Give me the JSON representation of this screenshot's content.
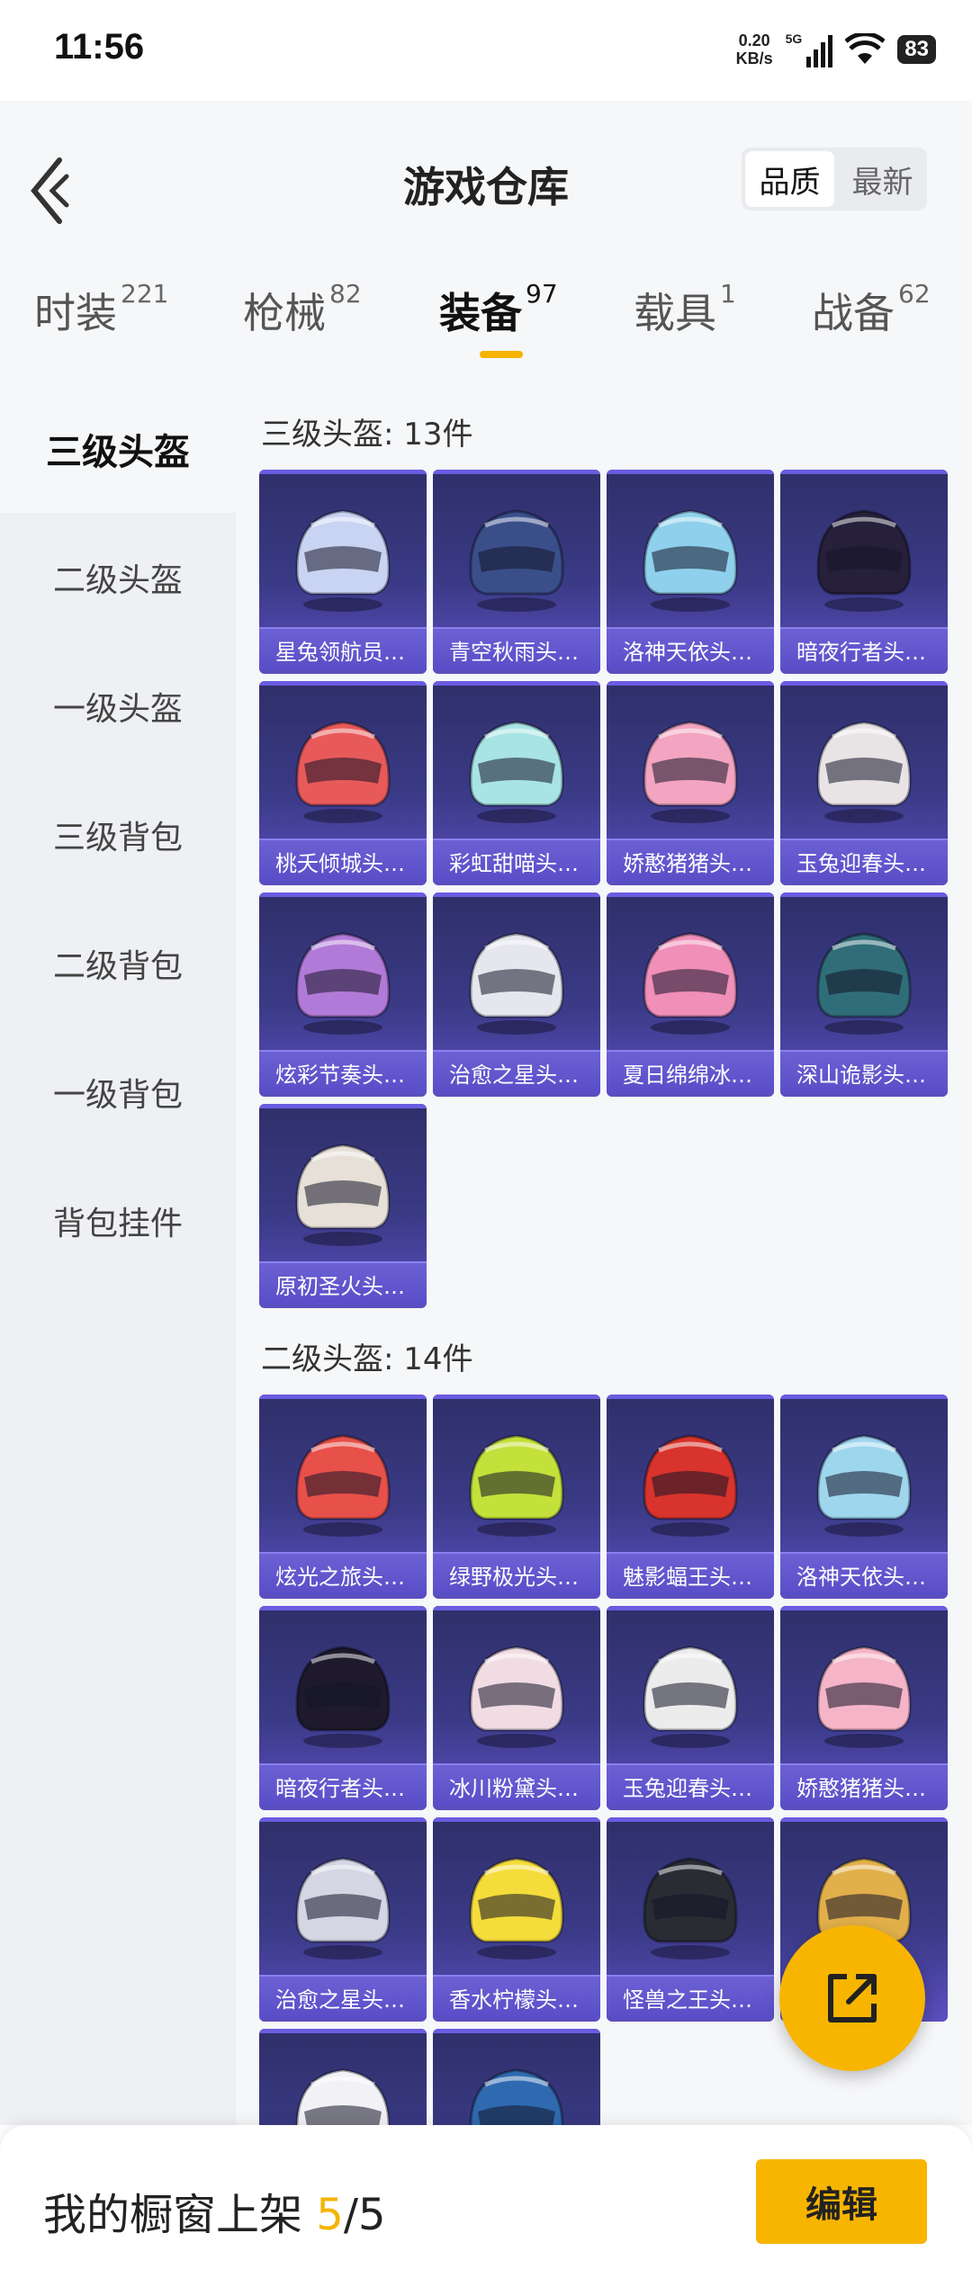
{
  "status_bar": {
    "time": "11:56",
    "net_speed_value": "0.20",
    "net_speed_unit": "KB/s",
    "network": "5G",
    "battery": "83"
  },
  "header": {
    "title": "游戏仓库",
    "sort_options": [
      "品质",
      "最新"
    ],
    "sort_selected": "品质"
  },
  "tabs": [
    {
      "name": "时装",
      "count": "221"
    },
    {
      "name": "枪械",
      "count": "82"
    },
    {
      "name": "装备",
      "count": "97",
      "active": true
    },
    {
      "name": "载具",
      "count": "1"
    },
    {
      "name": "战备",
      "count": "62"
    }
  ],
  "sidebar": {
    "items": [
      "三级头盔",
      "二级头盔",
      "一级头盔",
      "三级背包",
      "二级背包",
      "一级背包",
      "背包挂件"
    ],
    "active": "三级头盔"
  },
  "sections": [
    {
      "title": "三级头盔: 13件",
      "items": [
        {
          "label": "星兔领航员…",
          "color": "#c9d4f2"
        },
        {
          "label": "青空秋雨头…",
          "color": "#3a4f8a"
        },
        {
          "label": "洛神天依头…",
          "color": "#8fd0ec"
        },
        {
          "label": "暗夜行者头…",
          "color": "#26203a"
        },
        {
          "label": "桃夭倾城头…",
          "color": "#e85a5a"
        },
        {
          "label": "彩虹甜喵头…",
          "color": "#a8e4e4"
        },
        {
          "label": "娇憨猪猪头…",
          "color": "#f3a4c0"
        },
        {
          "label": "玉兔迎春头…",
          "color": "#e8e4e6"
        },
        {
          "label": "炫彩节奏头…",
          "color": "#b27ad8"
        },
        {
          "label": "治愈之星头…",
          "color": "#e6e6ee"
        },
        {
          "label": "夏日绵绵冰…",
          "color": "#f08fb8"
        },
        {
          "label": "深山诡影头…",
          "color": "#2f6e78"
        },
        {
          "label": "原初圣火头…",
          "color": "#e6e0d8"
        }
      ]
    },
    {
      "title": "二级头盔: 14件",
      "items": [
        {
          "label": "炫光之旅头…",
          "color": "#e8504a"
        },
        {
          "label": "绿野极光头…",
          "color": "#c4e03a"
        },
        {
          "label": "魅影蝠王头…",
          "color": "#d8332c"
        },
        {
          "label": "洛神天依头…",
          "color": "#9ed6ee"
        },
        {
          "label": "暗夜行者头…",
          "color": "#1e1a2c"
        },
        {
          "label": "冰川粉黛头…",
          "color": "#f2dce4"
        },
        {
          "label": "玉兔迎春头…",
          "color": "#ececec"
        },
        {
          "label": "娇憨猪猪头…",
          "color": "#f6b4c8"
        },
        {
          "label": "治愈之星头…",
          "color": "#d4d6e4"
        },
        {
          "label": "香水柠檬头…",
          "color": "#f4dc3a"
        },
        {
          "label": "怪兽之王头…",
          "color": "#2a2c34"
        },
        {
          "label": "",
          "color": "#e2b04a"
        },
        {
          "label": "",
          "color": "#f2f2f6"
        },
        {
          "label": "",
          "color": "#2f6ab0"
        }
      ]
    }
  ],
  "bottom": {
    "prefix": "我的橱窗上架 ",
    "count": "5",
    "total": "/5",
    "edit_label": "编辑"
  }
}
